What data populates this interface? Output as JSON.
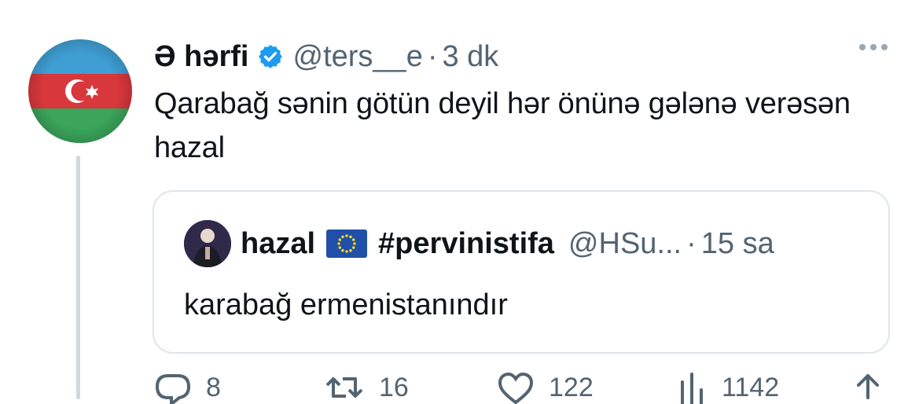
{
  "tweet": {
    "display_name": "Ə hərfi",
    "handle": "@ters__e",
    "separator": "·",
    "time": "3 dk",
    "text": "Qarabağ sənin götün deyil hər önünə gələnə verəsən hazal",
    "verified": true
  },
  "quote": {
    "display_name": "hazal",
    "hashtag": "#pervinistifa",
    "handle": "@HSu...",
    "separator": "·",
    "time": "15 sa",
    "text": "karabağ ermenistanındır"
  },
  "actions": {
    "replies": "8",
    "retweets": "16",
    "likes": "122",
    "views": "1142"
  },
  "icons": {
    "verified": "verified-badge-icon",
    "more": "more-icon",
    "reply": "reply-icon",
    "retweet": "retweet-icon",
    "like": "heart-icon",
    "views": "views-icon",
    "share": "share-icon"
  },
  "colors": {
    "verified": "#1d9bf0",
    "flag_blue": "#3f9fd4",
    "flag_red": "#d8373c",
    "flag_green": "#3aa55b",
    "eu_blue": "#1f4fa8",
    "secondary_text": "#536471"
  }
}
